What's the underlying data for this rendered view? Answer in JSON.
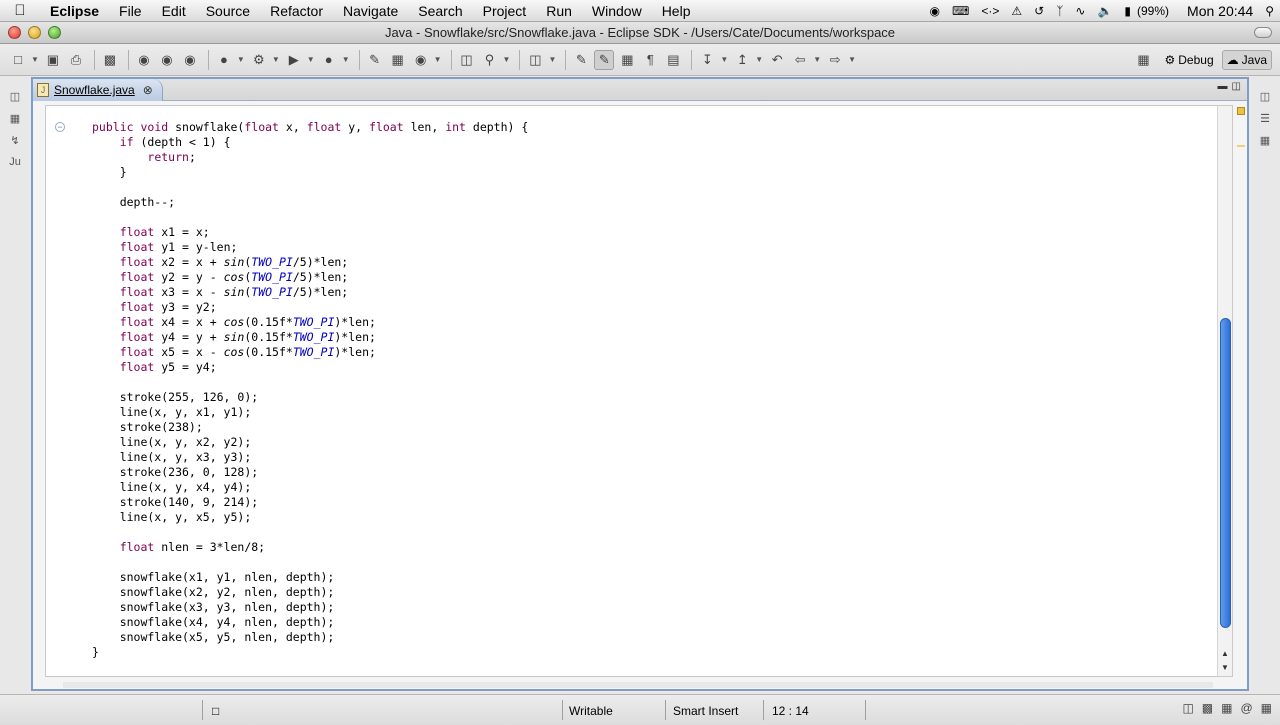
{
  "menubar": {
    "apple": "",
    "app_name": "Eclipse",
    "menus": [
      "File",
      "Edit",
      "Source",
      "Refactor",
      "Navigate",
      "Search",
      "Project",
      "Run",
      "Window",
      "Help"
    ],
    "battery": "(99%)",
    "clock": "Mon 20:44"
  },
  "window": {
    "title": "Java - Snowflake/src/Snowflake.java - Eclipse SDK - /Users/Cate/Documents/workspace"
  },
  "perspectives": {
    "debug": "Debug",
    "java": "Java"
  },
  "editor": {
    "tab_label": "Snowflake.java",
    "tab_icon_letter": "J",
    "lines": [
      "public void snowflake(float x, float y, float len, int depth) {",
      "    if (depth < 1) {",
      "        return;",
      "    }",
      "",
      "    depth--;",
      "",
      "    float x1 = x;",
      "    float y1 = y-len;",
      "    float x2 = x + sin(TWO_PI/5)*len;",
      "    float y2 = y - cos(TWO_PI/5)*len;",
      "    float x3 = x - sin(TWO_PI/5)*len;",
      "    float y3 = y2;",
      "    float x4 = x + cos(0.15f*TWO_PI)*len;",
      "    float y4 = y + sin(0.15f*TWO_PI)*len;",
      "    float x5 = x - cos(0.15f*TWO_PI)*len;",
      "    float y5 = y4;",
      "",
      "    stroke(255, 126, 0);",
      "    line(x, y, x1, y1);",
      "    stroke(238);",
      "    line(x, y, x2, y2);",
      "    line(x, y, x3, y3);",
      "    stroke(236, 0, 128);",
      "    line(x, y, x4, y4);",
      "    stroke(140, 9, 214);",
      "    line(x, y, x5, y5);",
      "",
      "    float nlen = 3*len/8;",
      "",
      "    snowflake(x1, y1, nlen, depth);",
      "    snowflake(x2, y2, nlen, depth);",
      "    snowflake(x3, y3, nlen, depth);",
      "    snowflake(x4, y4, nlen, depth);",
      "    snowflake(x5, y5, nlen, depth);",
      "}"
    ]
  },
  "status": {
    "writable": "Writable",
    "insert_mode": "Smart Insert",
    "position": "12 : 14"
  },
  "colors": {
    "keyword": "#7f0055",
    "constant": "#0000c0",
    "panel_border": "#7f9ec4"
  }
}
